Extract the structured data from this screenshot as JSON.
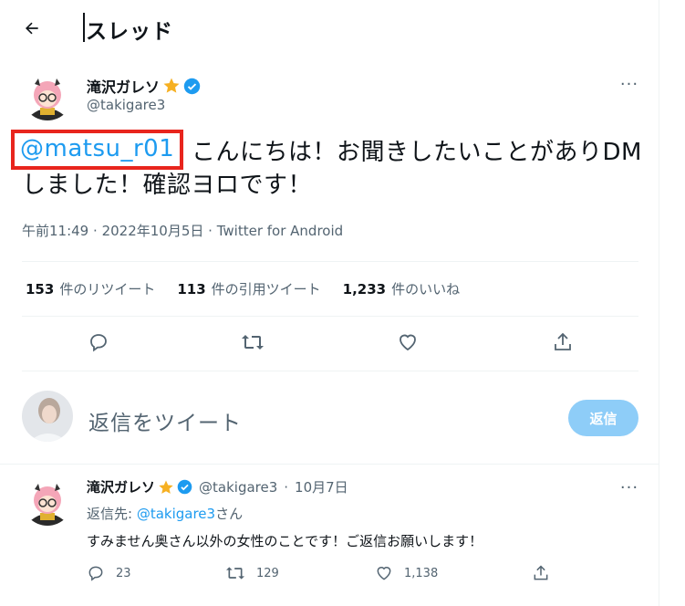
{
  "header": {
    "title": "スレッド"
  },
  "tweet": {
    "author_name": "滝沢ガレソ",
    "author_handle": "@takigare3",
    "mention": "@matsu_r01",
    "text": "こんにちは！お聞きしたいことがありDMしました！確認ヨロです！",
    "time": "午前11:49",
    "date": "2022年10月5日",
    "source": "Twitter for Android",
    "dot": "·",
    "stats": {
      "retweets_count": "153",
      "retweets_label": "件のリツイート",
      "quotes_count": "113",
      "quotes_label": "件の引用ツイート",
      "likes_count": "1,233",
      "likes_label": "件のいいね"
    },
    "more": "···"
  },
  "composer": {
    "placeholder": "返信をツイート",
    "button_label": "返信"
  },
  "reply": {
    "author_name": "滝沢ガレソ",
    "author_handle": "@takigare3",
    "date": "10月7日",
    "dot": "·",
    "replying_prefix": "返信先: ",
    "replying_to": "@takigare3",
    "replying_suffix": "さん",
    "text": "すみません奥さん以外の女性のことです！ご返信お願いします！",
    "reply_count": "23",
    "retweet_count": "129",
    "like_count": "1,138",
    "more": "···"
  },
  "colors": {
    "accent": "#1d9bf0",
    "highlight_box": "#e8251d",
    "reply_button": "#8ecdf8",
    "muted_text": "#536471"
  }
}
